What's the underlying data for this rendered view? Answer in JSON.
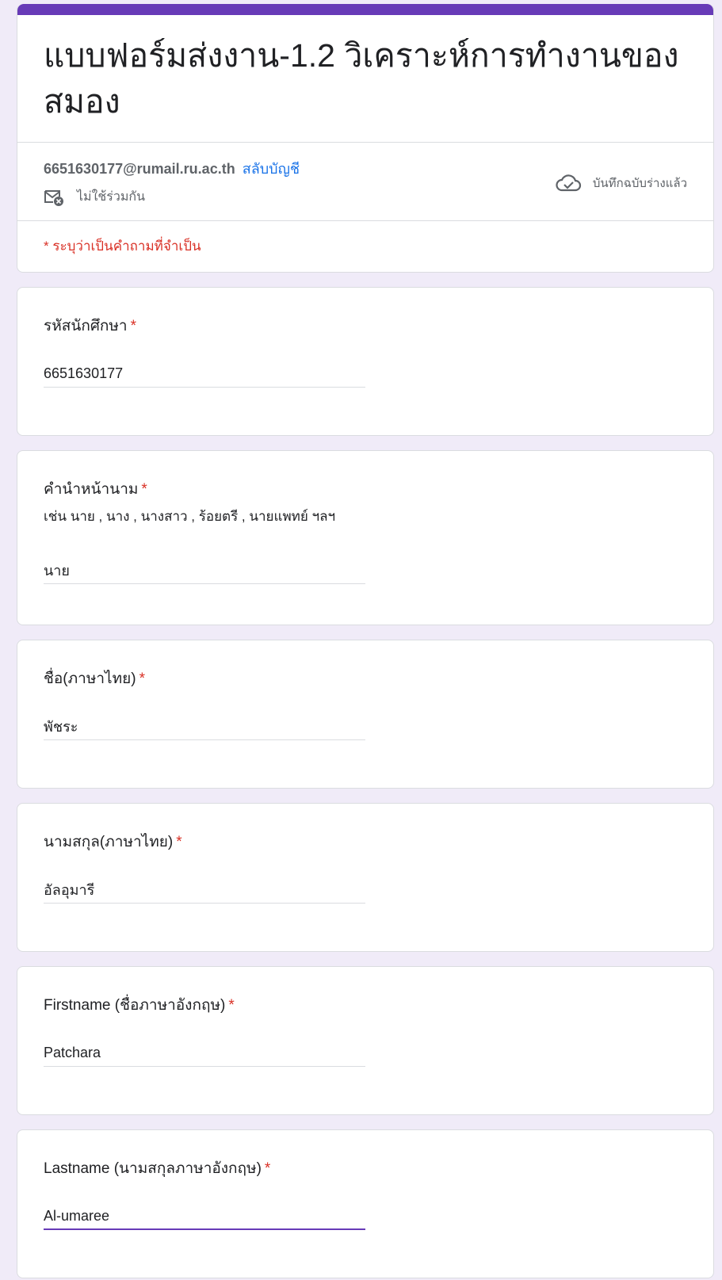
{
  "form": {
    "title": "แบบฟอร์มส่งงาน-1.2 วิเคราะห์การทำงานของสมอง",
    "account_email": "6651630177@rumail.ru.ac.th",
    "switch_account": "สลับบัญชี",
    "not_shared": "ไม่ใช้ร่วมกัน",
    "draft_saved": "บันทึกฉบับร่างแล้ว",
    "required_note": "* ระบุว่าเป็นคำถามที่จำเป็น"
  },
  "questions": [
    {
      "title": "รหัสนักศึกษา",
      "required": "*",
      "value": "6651630177"
    },
    {
      "title": "คำนำหน้านาม",
      "required": "*",
      "description": "เช่น นาย ,  นาง , นางสาว , ร้อยตรี , นายแพทย์ ฯลฯ",
      "value": "นาย"
    },
    {
      "title": "ชื่อ(ภาษาไทย)",
      "required": "*",
      "value": "พัชระ"
    },
    {
      "title": "นามสกุล(ภาษาไทย)",
      "required": "*",
      "value": "อัลอุมารี"
    },
    {
      "title": "Firstname (ชื่อภาษาอังกฤษ)",
      "required": "*",
      "value": "Patchara"
    },
    {
      "title": "Lastname (นามสกุลภาษาอังกฤษ)",
      "required": "*",
      "value": "Al-umaree"
    }
  ],
  "colors": {
    "accent": "#673ab7",
    "background": "#f0ebf8",
    "required": "#d93025",
    "link": "#1a73e8"
  },
  "icons": {
    "not_shared": "mail-x-icon",
    "saved": "cloud-check-icon"
  }
}
